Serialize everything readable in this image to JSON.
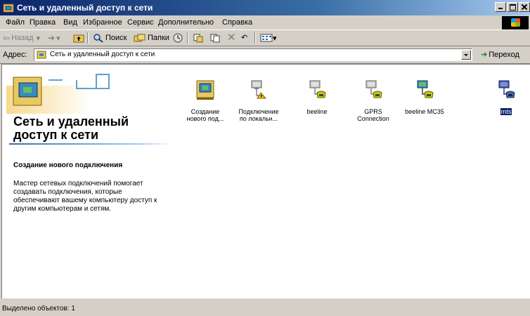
{
  "window": {
    "title": "Сеть и удаленный доступ к сети"
  },
  "menu": [
    "Файл",
    "Правка",
    "Вид",
    "Избранное",
    "Сервис",
    "Дополнительно",
    "Справка"
  ],
  "toolbar": {
    "back": "Назад",
    "search": "Поиск",
    "folders": "Папки"
  },
  "address": {
    "label": "Адрес:",
    "value": "Сеть и удаленный доступ к сети",
    "go": "Переход"
  },
  "pane": {
    "title": "Сеть и удаленный доступ к сети",
    "subtitle": "Создание нового подключения",
    "description": "Мастер сетевых подключений помогает создавать подключения, которые обеспечивают вашему компьютеру доступ к другим компьютерам и сетям."
  },
  "items": [
    {
      "label": "Создание нового под...",
      "icon": "new-connection-icon"
    },
    {
      "label": "Подключение по локальн...",
      "icon": "local-connection-icon"
    },
    {
      "label": "beeline",
      "icon": "dialup-connection-icon"
    },
    {
      "label": "GPRS Connection",
      "icon": "dialup-connection-icon"
    },
    {
      "label": "beeline MC35",
      "icon": "dialup-connection-icon"
    },
    {
      "label": "mts",
      "icon": "dialup-connection-icon"
    }
  ],
  "status": {
    "text": "Выделено объектов: 1"
  },
  "colors": {
    "titlebar": "#0a246a",
    "selection": "#0a246a",
    "face": "#d4d0c8"
  }
}
